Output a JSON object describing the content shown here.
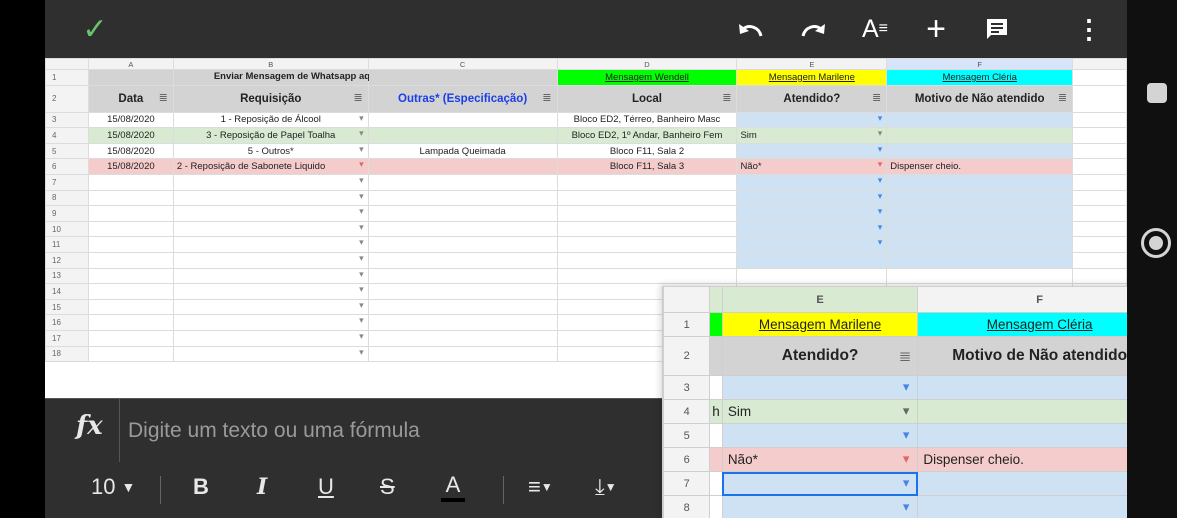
{
  "colors": {
    "topbar": "#2f2f2f",
    "check": "#6ac36b",
    "header_gray": "#d3d3d3",
    "green_row": "#d9ead3",
    "red_row": "#f4cccc",
    "blue_col": "#cfe2f3",
    "yellow": "#ffff00",
    "lime": "#00ff00",
    "cyan": "#00ffff",
    "selection": "#1a73e8"
  },
  "toolbar": {
    "confirm_icon": "check-icon",
    "undo_icon": "undo-icon",
    "redo_icon": "redo-icon",
    "text_format_icon": "text-format-icon",
    "insert_icon": "plus-icon",
    "comment_icon": "comment-icon",
    "more_icon": "more-vert-icon"
  },
  "columns": [
    "A",
    "B",
    "C",
    "D",
    "E",
    "F"
  ],
  "row_numbers": [
    "1",
    "2",
    "3",
    "4",
    "5",
    "6",
    "7",
    "8",
    "9",
    "10",
    "11",
    "12",
    "13",
    "14",
    "15",
    "16",
    "17",
    "18"
  ],
  "row1": {
    "b": "Enviar Mensagem de Whatsapp aqui -->",
    "d": "Mensagem Wendell",
    "e": "Mensagem Marilene",
    "f": "Mensagem Cléria"
  },
  "headers": {
    "a": "Data",
    "b": "Requisição",
    "c": "Outras* (Especificação)",
    "d": "Local",
    "e": "Atendido?",
    "f": "Motivo de Não atendido"
  },
  "rows": [
    {
      "a": "15/08/2020",
      "b": "1 - Reposição de Álcool",
      "c": "",
      "d": "Bloco ED2, Térreo, Banheiro Masc",
      "e": "",
      "f": ""
    },
    {
      "a": "15/08/2020",
      "b": "3 - Reposição de Papel Toalha",
      "c": "",
      "d": "Bloco ED2, 1º Andar, Banheiro Fem",
      "e": "Sim",
      "f": ""
    },
    {
      "a": "15/08/2020",
      "b": "5 - Outros*",
      "c": "Lampada Queimada",
      "d": "Bloco F11, Sala 2",
      "e": "",
      "f": ""
    },
    {
      "a": "15/08/2020",
      "b": "2 - Reposição de Sabonete Liquido",
      "c": "",
      "d": "Bloco F11, Sala 3",
      "e": "Não*",
      "f": "Dispenser cheio."
    }
  ],
  "formula_bar": {
    "icon": "fx",
    "placeholder": "Digite um texto ou uma fórmula"
  },
  "format_bar": {
    "font_size": "10",
    "bold": "B",
    "italic": "I",
    "underline": "U",
    "strike": "S",
    "text_color": "A"
  },
  "zoom": {
    "col_e": "E",
    "col_f": "F",
    "rows": [
      "1",
      "2",
      "3",
      "4",
      "5",
      "6",
      "7",
      "8"
    ],
    "row1_e": "Mensagem Marilene",
    "row1_f": "Mensagem Cléria",
    "header_e": "Atendido?",
    "header_f": "Motivo de Não atendido",
    "r4_frag": "h",
    "r4_e": "Sim",
    "r6_e": "Não*",
    "r6_f": "Dispenser cheio."
  }
}
